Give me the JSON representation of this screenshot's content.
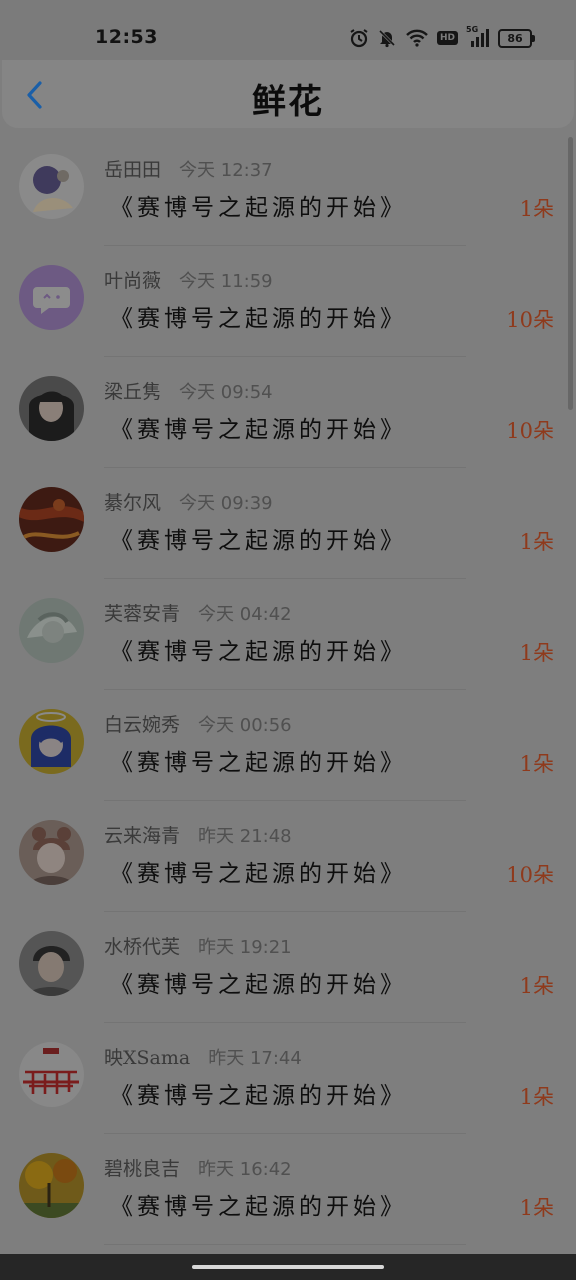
{
  "status_bar": {
    "time": "12:53",
    "hd": "HD",
    "network": "5G",
    "battery": "86",
    "icons": [
      "alarm-icon",
      "bell-mute-icon",
      "wifi-icon",
      "hd-icon",
      "signal-icon",
      "battery-icon"
    ]
  },
  "header": {
    "title": "鲜花",
    "back_icon": "chevron-left-icon"
  },
  "items": [
    {
      "name": "岳田田",
      "time": "今天 12:37",
      "work": "《赛博号之起源的开始》",
      "count": "1朵"
    },
    {
      "name": "叶尚薇",
      "time": "今天 11:59",
      "work": "《赛博号之起源的开始》",
      "count": "10朵"
    },
    {
      "name": "梁丘隽",
      "time": "今天 09:54",
      "work": "《赛博号之起源的开始》",
      "count": "10朵"
    },
    {
      "name": "綦尔风",
      "time": "今天 09:39",
      "work": "《赛博号之起源的开始》",
      "count": "1朵"
    },
    {
      "name": "芙蓉安青",
      "time": "今天 04:42",
      "work": "《赛博号之起源的开始》",
      "count": "1朵"
    },
    {
      "name": "白云婉秀",
      "time": "今天 00:56",
      "work": "《赛博号之起源的开始》",
      "count": "1朵"
    },
    {
      "name": "云来海青",
      "time": "昨天 21:48",
      "work": "《赛博号之起源的开始》",
      "count": "10朵"
    },
    {
      "name": "水桥代芙",
      "time": "昨天 19:21",
      "work": "《赛博号之起源的开始》",
      "count": "1朵"
    },
    {
      "name": "映XSama",
      "time": "昨天 17:44",
      "work": "《赛博号之起源的开始》",
      "count": "1朵"
    },
    {
      "name": "碧桃良吉",
      "time": "昨天 16:42",
      "work": "《赛博号之起源的开始》",
      "count": "1朵"
    }
  ],
  "colors": {
    "accent": "#1a5fa8",
    "count": "#8f3a1c",
    "overlay": "#7e7e7e"
  }
}
